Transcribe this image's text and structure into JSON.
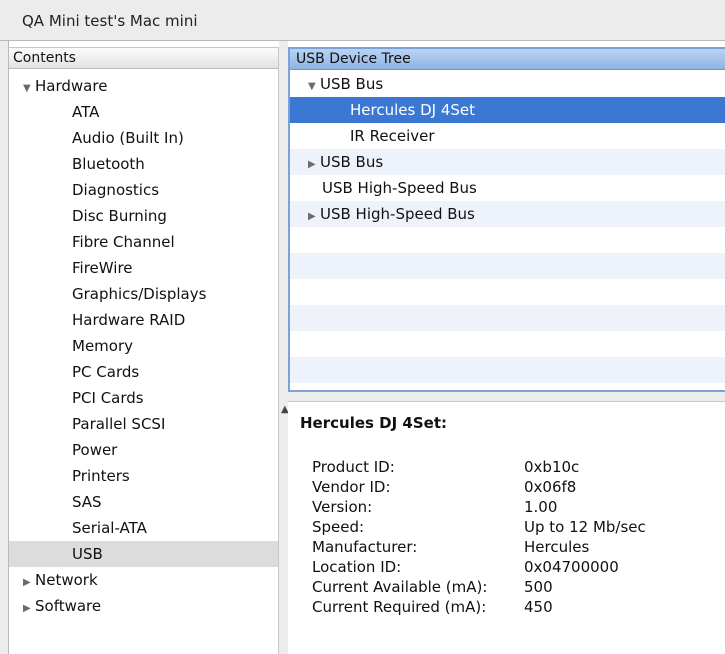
{
  "window": {
    "title": "QA Mini test's Mac mini"
  },
  "sidebar": {
    "header": "Contents",
    "items": [
      {
        "label": "Hardware",
        "level": 0,
        "disclosure": "expanded"
      },
      {
        "label": "ATA",
        "level": 1
      },
      {
        "label": "Audio (Built In)",
        "level": 1
      },
      {
        "label": "Bluetooth",
        "level": 1
      },
      {
        "label": "Diagnostics",
        "level": 1
      },
      {
        "label": "Disc Burning",
        "level": 1
      },
      {
        "label": "Fibre Channel",
        "level": 1
      },
      {
        "label": "FireWire",
        "level": 1
      },
      {
        "label": "Graphics/Displays",
        "level": 1
      },
      {
        "label": "Hardware RAID",
        "level": 1
      },
      {
        "label": "Memory",
        "level": 1
      },
      {
        "label": "PC Cards",
        "level": 1
      },
      {
        "label": "PCI Cards",
        "level": 1
      },
      {
        "label": "Parallel SCSI",
        "level": 1
      },
      {
        "label": "Power",
        "level": 1
      },
      {
        "label": "Printers",
        "level": 1
      },
      {
        "label": "SAS",
        "level": 1
      },
      {
        "label": "Serial-ATA",
        "level": 1
      },
      {
        "label": "USB",
        "level": 1,
        "selected": true
      },
      {
        "label": "Network",
        "level": 0,
        "disclosure": "collapsed"
      },
      {
        "label": "Software",
        "level": 0,
        "disclosure": "collapsed"
      }
    ]
  },
  "device_tree": {
    "header": "USB Device Tree",
    "rows": [
      {
        "label": "USB Bus",
        "level": 0,
        "disclosure": "expanded"
      },
      {
        "label": "Hercules DJ 4Set",
        "level": 1,
        "selected": true
      },
      {
        "label": "IR Receiver",
        "level": 1
      },
      {
        "label": "USB Bus",
        "level": 0,
        "disclosure": "collapsed"
      },
      {
        "label": "USB High-Speed Bus",
        "level": 0
      },
      {
        "label": "USB High-Speed Bus",
        "level": 0,
        "disclosure": "collapsed"
      }
    ]
  },
  "detail": {
    "title": "Hercules DJ 4Set:",
    "properties": [
      {
        "key": "Product ID:",
        "value": "0xb10c"
      },
      {
        "key": "Vendor ID:",
        "value": "0x06f8"
      },
      {
        "key": "Version:",
        "value": "1.00"
      },
      {
        "key": "Speed:",
        "value": "Up to 12 Mb/sec"
      },
      {
        "key": "Manufacturer:",
        "value": "Hercules"
      },
      {
        "key": "Location ID:",
        "value": "0x04700000"
      },
      {
        "key": "Current Available (mA):",
        "value": "500"
      },
      {
        "key": "Current Required (mA):",
        "value": "450"
      }
    ]
  },
  "icons": {
    "expanded": "disclosure-triangle-down-icon",
    "collapsed": "disclosure-triangle-right-icon",
    "split_handle": "split-handle-icon"
  }
}
